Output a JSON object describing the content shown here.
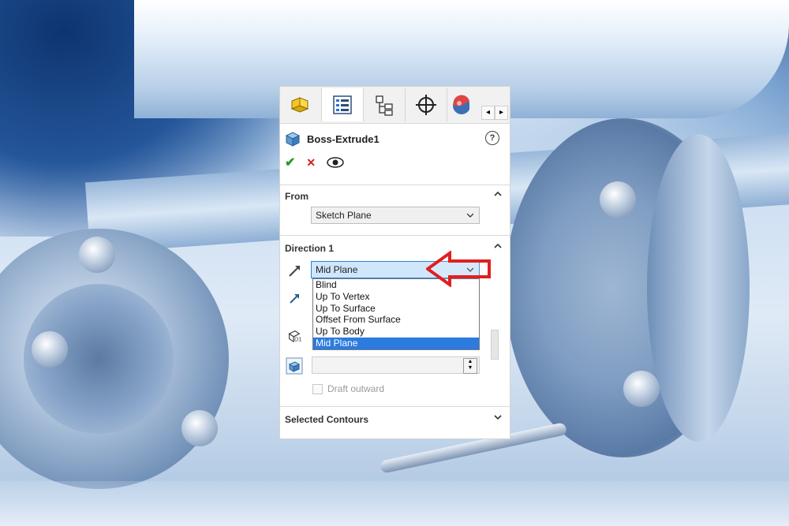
{
  "panel": {
    "tabs": [
      {
        "name": "feature-manager-tab",
        "icon": "feature-part-icon"
      },
      {
        "name": "property-manager-tab",
        "icon": "property-list-icon"
      },
      {
        "name": "configuration-manager-tab",
        "icon": "configuration-tree-icon"
      },
      {
        "name": "dimxpert-manager-tab",
        "icon": "crosshair-icon"
      },
      {
        "name": "display-manager-tab",
        "icon": "appearance-sphere-icon"
      }
    ],
    "tab_scroll_left": "◂",
    "tab_scroll_right": "▸",
    "title": "Boss-Extrude1",
    "help_label": "?",
    "ok_symbol": "✔",
    "cancel_symbol": "✕"
  },
  "from_group": {
    "title": "From",
    "selected": "Sketch Plane"
  },
  "direction1_group": {
    "title": "Direction 1",
    "selected": "Mid Plane",
    "options": [
      "Blind",
      "Up To Vertex",
      "Up To Surface",
      "Offset From Surface",
      "Up To Body",
      "Mid Plane"
    ],
    "selected_index": 5,
    "draft_label": "Draft outward"
  },
  "selected_contours_group": {
    "title": "Selected Contours"
  },
  "colors": {
    "accent_blue": "#2c7be0",
    "annotation_red": "#e02020",
    "ok_green": "#2a9a2a"
  }
}
